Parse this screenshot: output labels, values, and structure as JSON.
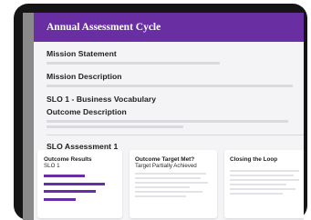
{
  "header": {
    "title": "Annual Assessment Cycle"
  },
  "sections": {
    "mission_statement": "Mission Statement",
    "mission_description": "Mission Description",
    "slo": "SLO 1 - Business Vocabulary",
    "outcome_description": "Outcome Description",
    "slo_assessment": "SLO Assessment 1"
  },
  "cards": {
    "outcome_results": {
      "title": "Outcome Results",
      "subtitle": "SLO 1"
    },
    "outcome_target": {
      "title": "Outcome Target Met?",
      "subtitle": "Target Partially Achieved"
    },
    "closing_loop": {
      "title": "Closing the Loop"
    }
  },
  "colors": {
    "accent": "#6a2ea3",
    "frame": "#151515"
  }
}
